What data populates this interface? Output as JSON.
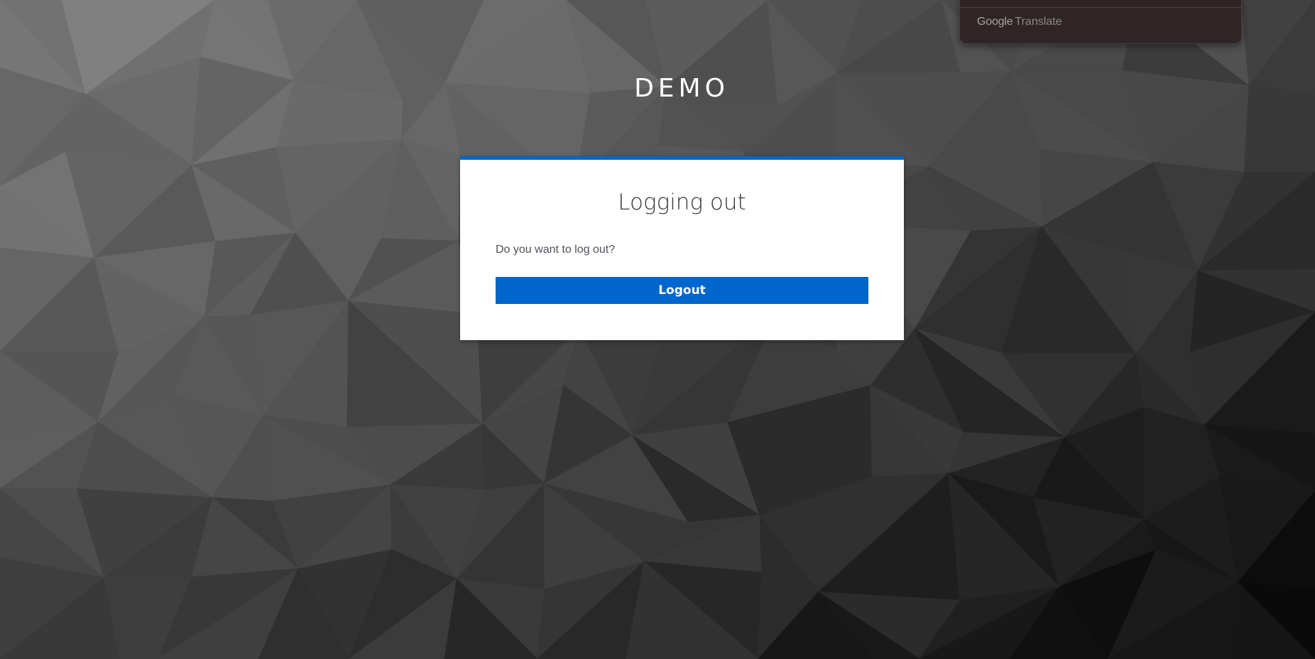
{
  "brand": {
    "title": "DEMO"
  },
  "translate_widget": {
    "brand_google": "Google",
    "brand_translate": "Translate"
  },
  "logout_card": {
    "title": "Logging out",
    "prompt": "Do you want to log out?",
    "button_label": "Logout"
  },
  "colors": {
    "accent": "#0066cc",
    "card_background": "#ffffff",
    "page_background": "#3a3a3a",
    "translate_popup": "#2f2526"
  }
}
